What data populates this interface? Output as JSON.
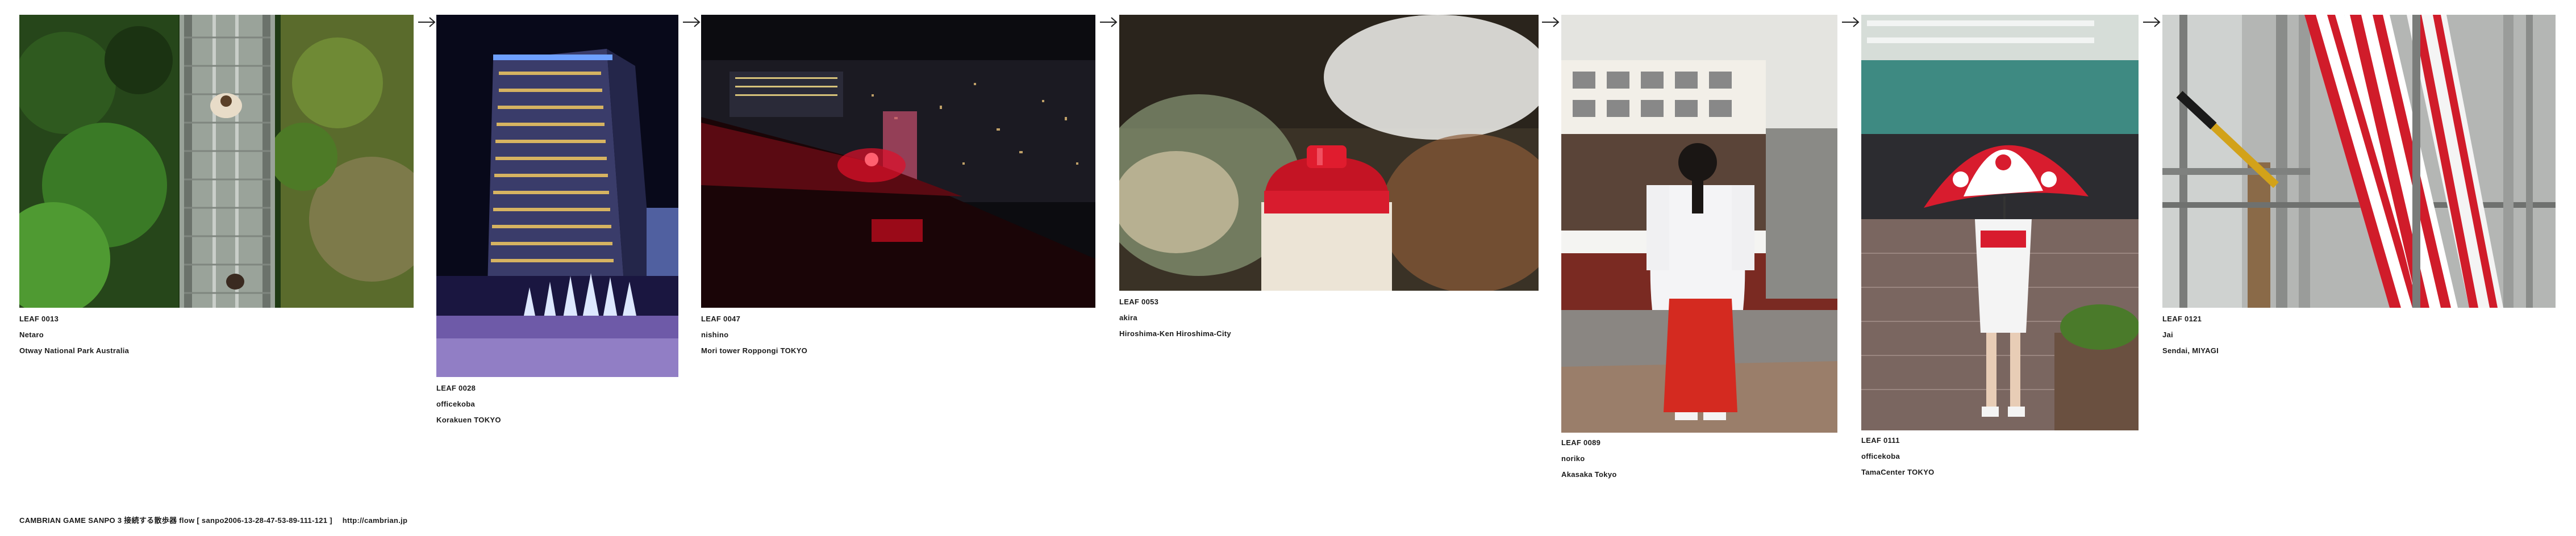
{
  "leaves": [
    {
      "id": "LEAF 0013",
      "author": "Netaro",
      "place": "Otway National Park Australia",
      "thumbnail": "forest canopy walkway viewed from above"
    },
    {
      "id": "LEAF 0028",
      "author": "officekoba",
      "place": "Korakuen TOKYO",
      "thumbnail": "hotel tower at night with illuminated trees"
    },
    {
      "id": "LEAF 0047",
      "author": "nishino",
      "place": "Mori tower Roppongi TOKYO",
      "thumbnail": "night city view with red rooftop light"
    },
    {
      "id": "LEAF 0053",
      "author": "akira",
      "place": "Hiroshima-Ken Hiroshima-City",
      "thumbnail": "close-up of a red bottle cap"
    },
    {
      "id": "LEAF 0089",
      "author": "noriko",
      "place": "Akasaka Tokyo",
      "thumbnail": "shrine maiden in red and white robes"
    },
    {
      "id": "LEAF 0111",
      "author": "officekoba",
      "place": "TamaCenter TOKYO",
      "thumbnail": "woman holding red and white umbrella"
    },
    {
      "id": "LEAF 0121",
      "author": "Jai",
      "place": "Sendai, MIYAGI",
      "thumbnail": "red and white striped poles"
    }
  ],
  "footer": {
    "title": "CAMBRIAN GAME  SANPO 3 接続する散歩器 flow [ sanpo2006-13-28-47-53-89-111-121 ]",
    "url": "http://cambrian.jp"
  },
  "icons": {
    "arrow": "right-arrow-icon"
  },
  "colors": {
    "text": "#1a1a1a",
    "background": "#ffffff",
    "accent_red": "#c8102e"
  }
}
